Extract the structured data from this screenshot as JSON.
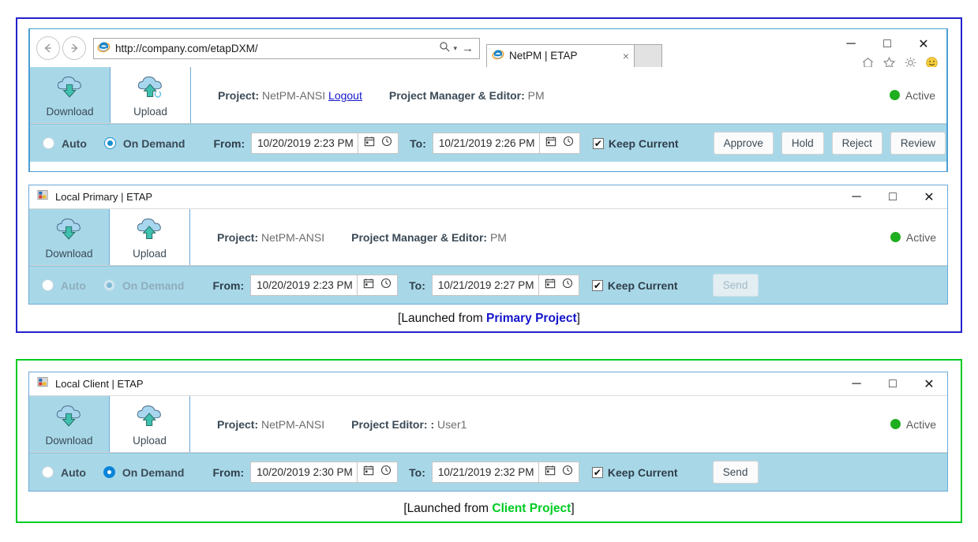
{
  "browser": {
    "address_url": "http://company.com/etapDXM/",
    "tab_title": "NetPM | ETAP",
    "nav_back_icon": "back-arrow-icon",
    "nav_forward_icon": "forward-arrow-icon",
    "search_icon": "search-icon",
    "go_icon": "go-arrow-icon",
    "tab_close_label": "×",
    "minimize_label": "─",
    "maximize_label": "□",
    "close_label": "✕",
    "toolbar_icons": [
      "home-icon",
      "favorites-star-icon",
      "settings-gear-icon",
      "smiley-feedback-icon"
    ]
  },
  "ribbon": {
    "download_label": "Download",
    "upload_label": "Upload",
    "download_icon": "cloud-download-icon",
    "upload_icon": "cloud-upload-icon"
  },
  "panels": {
    "primary_browser": {
      "project_label": "Project:",
      "project_value": "NetPM-ANSI",
      "logout_label": "Logout",
      "role_label": "Project Manager & Editor:",
      "role_value": "PM",
      "status_text": "Active",
      "status_color": "#1fae1f",
      "mode_auto_label": "Auto",
      "mode_ondemand_label": "On Demand",
      "mode_selected": "On Demand",
      "from_label": "From:",
      "from_value": "10/20/2019 2:23 PM",
      "to_label": "To:",
      "to_value": "10/21/2019 2:26 PM",
      "keep_current_label": "Keep Current",
      "keep_current_checked": true,
      "buttons": [
        {
          "label": "Approve",
          "disabled": false
        },
        {
          "label": "Hold",
          "disabled": false
        },
        {
          "label": "Reject",
          "disabled": false
        },
        {
          "label": "Review",
          "disabled": false
        }
      ]
    },
    "local_primary": {
      "window_title": "Local Primary | ETAP",
      "project_label": "Project:",
      "project_value": "NetPM-ANSI",
      "role_label": "Project Manager & Editor:",
      "role_value": "PM",
      "status_text": "Active",
      "status_color": "#1fae1f",
      "mode_auto_label": "Auto",
      "mode_ondemand_label": "On Demand",
      "mode_disabled": true,
      "from_label": "From:",
      "from_value": "10/20/2019 2:23 PM",
      "to_label": "To:",
      "to_value": "10/21/2019 2:27 PM",
      "keep_current_label": "Keep Current",
      "keep_current_checked": true,
      "send_label": "Send",
      "send_disabled": true
    },
    "local_client": {
      "window_title": "Local Client | ETAP",
      "project_label": "Project:",
      "project_value": "NetPM-ANSI",
      "role_label": "Project Editor: :",
      "role_value": "User1",
      "status_text": "Active",
      "status_color": "#1fae1f",
      "mode_auto_label": "Auto",
      "mode_ondemand_label": "On Demand",
      "mode_selected": "On Demand",
      "from_label": "From:",
      "from_value": "10/20/2019 2:30 PM",
      "to_label": "To:",
      "to_value": "10/21/2019 2:32 PM",
      "keep_current_label": "Keep Current",
      "keep_current_checked": true,
      "send_label": "Send",
      "send_disabled": false
    }
  },
  "captions": {
    "primary_prefix": "[Launched from ",
    "primary_bold": "Primary Project",
    "primary_suffix": "]",
    "primary_color": "#1414cc",
    "client_prefix": "[Launched from ",
    "client_bold": "Client Project",
    "client_suffix": "]",
    "client_color": "#00cc22"
  },
  "window_controls": {
    "minimize": "─",
    "maximize": "□",
    "close": "✕"
  }
}
